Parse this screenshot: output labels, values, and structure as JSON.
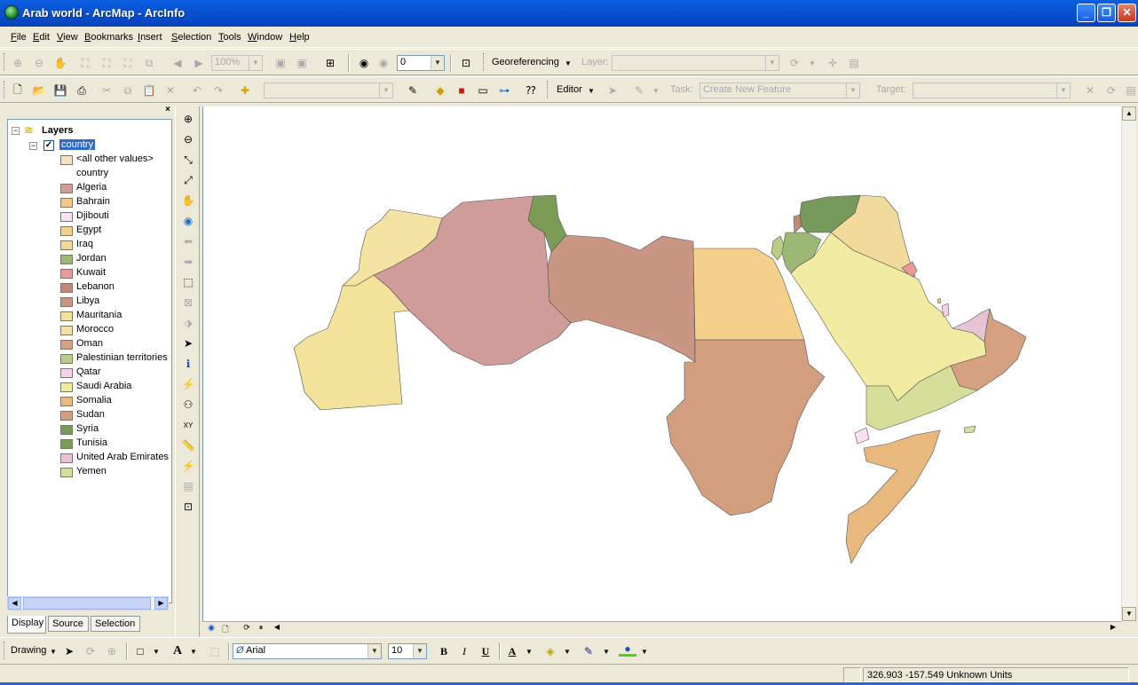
{
  "window": {
    "title": "Arab world - ArcMap - ArcInfo"
  },
  "menu": [
    "File",
    "Edit",
    "View",
    "Bookmarks",
    "Insert",
    "Selection",
    "Tools",
    "Window",
    "Help"
  ],
  "tools_toolbar": {
    "zoom_level": "100%",
    "layer_index_value": "0",
    "georeferencing_label": "Georeferencing",
    "layer_label": "Layer:",
    "layer_value": ""
  },
  "standard_toolbar": {
    "scale_value": "",
    "editor_label": "Editor",
    "task_label": "Task:",
    "task_value": "Create New Feature",
    "target_label": "Target:",
    "target_value": ""
  },
  "toc": {
    "root_label": "Layers",
    "layer_label": "country",
    "all_other_values": "<all other values>",
    "field_name": "country",
    "legend": [
      {
        "label": "Algeria",
        "color": "#d09c99"
      },
      {
        "label": "Bahrain",
        "color": "#f5c68a"
      },
      {
        "label": "Djibouti",
        "color": "#f7e2f2"
      },
      {
        "label": "Egypt",
        "color": "#f5d08a"
      },
      {
        "label": "Iraq",
        "color": "#f2d99c"
      },
      {
        "label": "Jordan",
        "color": "#9cb875"
      },
      {
        "label": "Kuwait",
        "color": "#ea9898"
      },
      {
        "label": "Lebanon",
        "color": "#c48877"
      },
      {
        "label": "Libya",
        "color": "#c89683"
      },
      {
        "label": "Mauritania",
        "color": "#f2e29a"
      },
      {
        "label": "Morocco",
        "color": "#f5e3a3"
      },
      {
        "label": "Oman",
        "color": "#d6a180"
      },
      {
        "label": "Palestinian territories",
        "color": "#b9cc88"
      },
      {
        "label": "Qatar",
        "color": "#f4d1e6"
      },
      {
        "label": "Saudi Arabia",
        "color": "#f2eba2"
      },
      {
        "label": "Somalia",
        "color": "#e8b87c"
      },
      {
        "label": "Sudan",
        "color": "#d39e7e"
      },
      {
        "label": "Syria",
        "color": "#759a5a"
      },
      {
        "label": "Tunisia",
        "color": "#7a9c55"
      },
      {
        "label": "United Arab Emirates",
        "color": "#e8c3d3"
      },
      {
        "label": "Yemen",
        "color": "#d6df9a"
      }
    ],
    "all_other_color": "#f7e1c4",
    "tabs": [
      "Display",
      "Source",
      "Selection"
    ]
  },
  "drawing_toolbar": {
    "drawing_label": "Drawing",
    "font_value": "Arial",
    "font_size_value": "10",
    "bold": "B",
    "italic": "I",
    "underline": "U"
  },
  "status": {
    "coordinates": "326.903  -157.549 Unknown Units"
  }
}
